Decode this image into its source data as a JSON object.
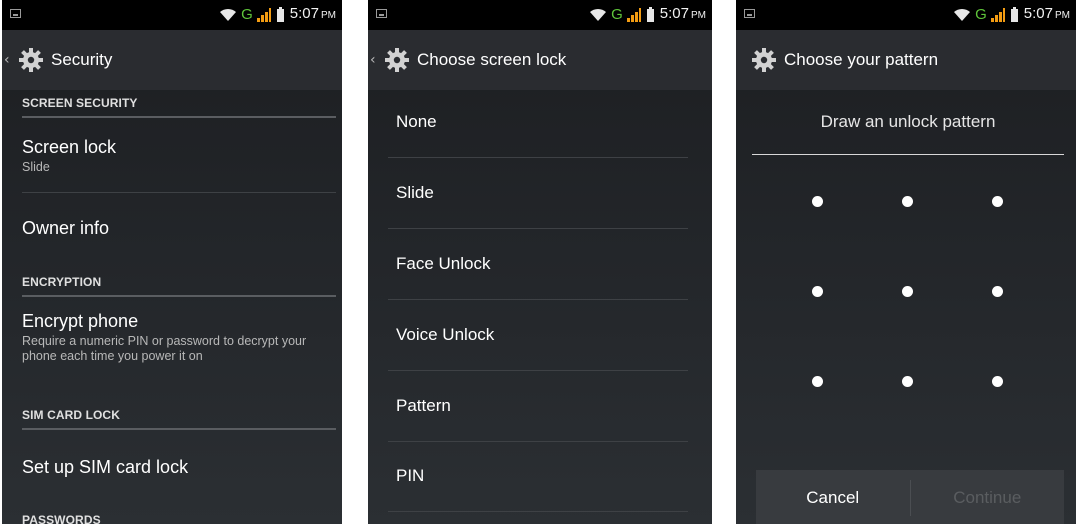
{
  "status_bar": {
    "network_type": "G",
    "time": "5:07",
    "ampm": "PM"
  },
  "panel1": {
    "title": "Security",
    "screen_security": {
      "header": "SCREEN SECURITY",
      "screen_lock": {
        "title": "Screen lock",
        "summary": "Slide"
      },
      "owner_info": {
        "title": "Owner info"
      }
    },
    "encryption": {
      "header": "ENCRYPTION",
      "encrypt_phone": {
        "title": "Encrypt phone",
        "summary": "Require a numeric PIN or password to decrypt your phone each time you power it on"
      }
    },
    "sim_card_lock": {
      "header": "SIM CARD LOCK",
      "setup": {
        "title": "Set up SIM card lock"
      }
    },
    "passwords": {
      "header": "PASSWORDS"
    }
  },
  "panel2": {
    "title": "Choose screen lock",
    "options": [
      "None",
      "Slide",
      "Face Unlock",
      "Voice Unlock",
      "Pattern",
      "PIN"
    ]
  },
  "panel3": {
    "title": "Choose your pattern",
    "header": "Draw an unlock pattern",
    "cancel": "Cancel",
    "continue": "Continue",
    "continue_enabled": false
  },
  "icons": {
    "settings": "gear-icon",
    "back": "chevron-left-icon",
    "wifi": "wifi-icon",
    "signal": "signal-bars-icon",
    "battery": "battery-icon",
    "notification": "notification-icon"
  },
  "colors": {
    "statusbar_bg": "#000000",
    "actionbar_bg": "#2a2c30",
    "network_g": "#5fc43a",
    "divider": "#3e4145",
    "disabled_text": "#5a5d60"
  }
}
